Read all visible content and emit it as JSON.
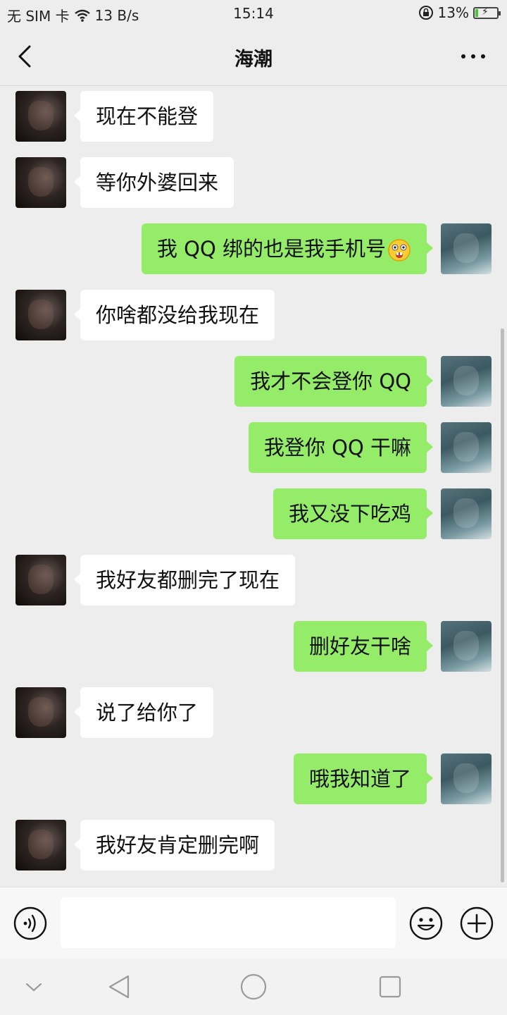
{
  "status_bar": {
    "sim": "无 SIM 卡",
    "speed": "13 B/s",
    "time": "15:14",
    "battery_text": "13%",
    "battery_level": 0.13
  },
  "header": {
    "title": "海潮",
    "back_icon": "chevron-left-icon",
    "more_icon": "more-dots-icon"
  },
  "messages": [
    {
      "side": "left",
      "text": "现在不能登"
    },
    {
      "side": "left",
      "text": "等你外婆回来"
    },
    {
      "side": "right",
      "text": "我 QQ 绑的也是我手机号",
      "emoji": "shocked-face-emoji"
    },
    {
      "side": "left",
      "text": "你啥都没给我现在"
    },
    {
      "side": "right",
      "text": "我才不会登你 QQ"
    },
    {
      "side": "right",
      "text": "我登你 QQ 干嘛"
    },
    {
      "side": "right",
      "text": "我又没下吃鸡"
    },
    {
      "side": "left",
      "text": "我好友都删完了现在"
    },
    {
      "side": "right",
      "text": "删好友干啥"
    },
    {
      "side": "left",
      "text": "说了给你了"
    },
    {
      "side": "right",
      "text": "哦我知道了"
    },
    {
      "side": "left",
      "text": "我好友肯定删完啊"
    }
  ],
  "input_bar": {
    "value": "",
    "voice_icon": "voice-icon",
    "emoji_icon": "emoji-icon",
    "plus_icon": "plus-icon"
  },
  "system_nav": {
    "icons": [
      "chevron-down-icon",
      "back-triangle-icon",
      "home-circle-icon",
      "recents-square-icon"
    ]
  },
  "colors": {
    "background": "#ededed",
    "sent_bubble": "#95ec69",
    "received_bubble": "#ffffff"
  }
}
